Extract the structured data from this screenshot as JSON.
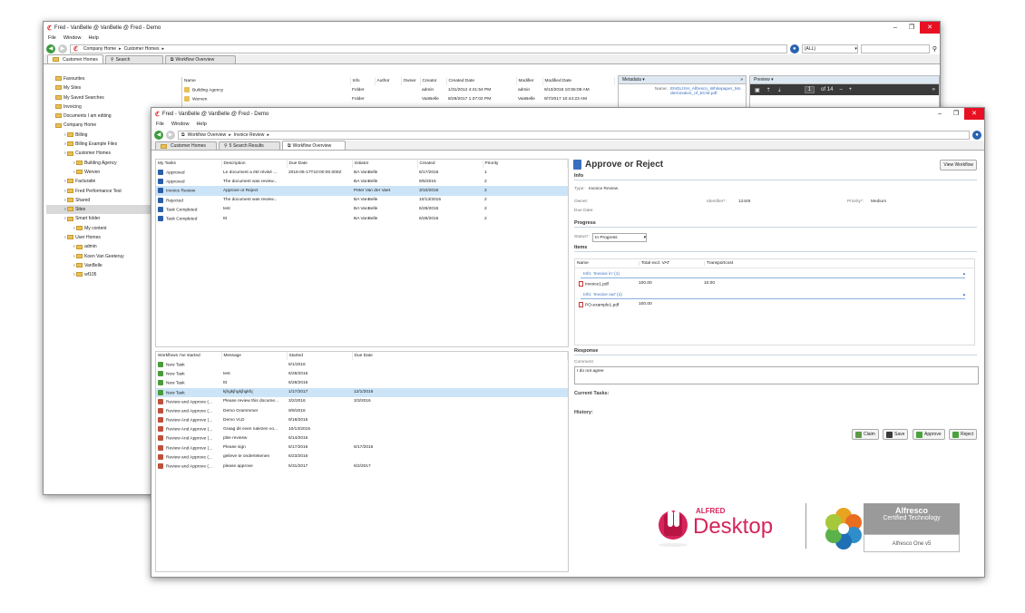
{
  "back_window": {
    "title": "Fred - VanBelle @ VanBelle @ Fred - Demo",
    "menu": [
      "File",
      "Window",
      "Help"
    ],
    "breadcrumb": [
      "Company Home",
      "Customer Homes"
    ],
    "scope_select": "(ALL)",
    "tabs": [
      "Customer Homes",
      "Search",
      "Workflow Overview"
    ],
    "tree": [
      {
        "label": "Favourites",
        "indent": 1
      },
      {
        "label": "My Sites",
        "indent": 1
      },
      {
        "label": "My Saved Searches",
        "indent": 1
      },
      {
        "label": "Invoicing",
        "indent": 1
      },
      {
        "label": "Documents I am editing",
        "indent": 1
      },
      {
        "label": "Company Home",
        "indent": 1
      },
      {
        "label": "Billing",
        "indent": 2
      },
      {
        "label": "Billing Example Files",
        "indent": 2
      },
      {
        "label": "Customer Homes",
        "indent": 2
      },
      {
        "label": "Building Agency",
        "indent": 3
      },
      {
        "label": "Werven",
        "indent": 3
      },
      {
        "label": "Facturatie",
        "indent": 2
      },
      {
        "label": "Fred Performance Test",
        "indent": 2
      },
      {
        "label": "Shared",
        "indent": 2
      },
      {
        "label": "Sites",
        "indent": 2,
        "selected": true
      },
      {
        "label": "Smart folder",
        "indent": 2
      },
      {
        "label": "My content",
        "indent": 3
      },
      {
        "label": "User Homes",
        "indent": 2
      },
      {
        "label": "admin",
        "indent": 3
      },
      {
        "label": "Koen Van Geeteruy",
        "indent": 3
      },
      {
        "label": "VanBelle",
        "indent": 3
      },
      {
        "label": "wf105",
        "indent": 3
      }
    ],
    "columns": [
      "Name",
      "Info",
      "Author",
      "Owner",
      "Creator",
      "Created Date",
      "Modifier",
      "Modified Date"
    ],
    "rows": [
      [
        "Building Agency",
        "Folder",
        "",
        "",
        "admin",
        "1/31/2012 4:41:54 PM",
        "admin",
        "9/13/2016 10:55:08 AM"
      ],
      [
        "Werven",
        "Folder",
        "",
        "",
        "VanBelle",
        "8/29/2017 1:37:02 PM",
        "VanBelle",
        "9/7/2017 10:44:23 AM"
      ]
    ],
    "metadata_header": "Metadata",
    "metadata_name_label": "Name:",
    "metadata_name_value": "ENGLISH_Alfresco_Whitepaper_Modernization_of_ECM.pdf",
    "preview_header": "Preview",
    "preview_page": "1",
    "preview_of": "of 14"
  },
  "front_window": {
    "title": "Fred - VanBelle @ VanBelle @ Fred - Demo",
    "menu": [
      "File",
      "Window",
      "Help"
    ],
    "breadcrumb": [
      "Workflow Overview",
      "Invoice Review"
    ],
    "tabs": [
      "Customer Homes",
      "5 Search Results",
      "Workflow Overview"
    ],
    "tasks_columns": [
      "My Tasks",
      "Description",
      "Due Date",
      "Initiator",
      "Created",
      "Priority"
    ],
    "tasks": [
      [
        "Approved",
        "Le document a été révisé ...",
        "2016-06-17T10:00:00.000Z",
        "BA VanBelle",
        "6/17/2016",
        "1"
      ],
      [
        "Approved",
        "The document was review...",
        "",
        "BA VanBelle",
        "9/5/2016",
        "2"
      ],
      [
        "Invoice Review",
        "Approve or Reject",
        "",
        "Peter Van der Vaet",
        "3/10/2015",
        "2"
      ],
      [
        "Rejected",
        "The document was review...",
        "",
        "BA VanBelle",
        "10/13/2015",
        "2"
      ],
      [
        "Task Completed",
        "test",
        "",
        "BA VanBelle",
        "6/28/2016",
        "2"
      ],
      [
        "Task Completed",
        "ttt",
        "",
        "BA VanBelle",
        "6/28/2016",
        "2"
      ]
    ],
    "wf_columns": [
      "Workflows I've started",
      "Message",
      "Started",
      "Due Date"
    ],
    "workflows": [
      [
        "New Task",
        "",
        "6/1/2016",
        ""
      ],
      [
        "New Task",
        "test",
        "6/28/2016",
        ""
      ],
      [
        "New Task",
        "ttt",
        "6/28/2016",
        ""
      ],
      [
        "New Task",
        "kjhgkjhgkjhgkhj",
        "1/17/2017",
        "12/1/2016"
      ],
      [
        "Review and Approve (...",
        "Please review this docume...",
        "3/2/2016",
        "3/3/2016"
      ],
      [
        "Review and Approve (...",
        "Demo Grammmer",
        "9/9/2016",
        ""
      ],
      [
        "Review And Approve (...",
        "Demo VLD",
        "9/18/2015",
        ""
      ],
      [
        "Review And Approve (...",
        "Graag dit even nalezen vo...",
        "10/13/2015",
        ""
      ],
      [
        "Review And Approve (...",
        "plse reviesw",
        "6/14/2016",
        ""
      ],
      [
        "Review And Approve (...",
        "Please sign",
        "6/17/2016",
        "6/17/2016"
      ],
      [
        "Review and Approve (...",
        "gelieve te ondertekenen",
        "6/23/2016",
        ""
      ],
      [
        "Review and Approve (...",
        "please approve",
        "5/31/2017",
        "6/2/2017"
      ]
    ],
    "detail": {
      "title": "Approve or Reject",
      "view_workflow": "View Workflow",
      "info_section": "Info",
      "type_label": "Type:",
      "type_value": "Invoice Review",
      "owner_label": "Owner:",
      "identifier_label": "Identifier*:",
      "identifier_value": "12449",
      "priority_label": "Priority*:",
      "priority_value": "Medium",
      "due_label": "Due Date:",
      "progress_section": "Progress",
      "status_label": "Status*:",
      "status_value": "In Progress",
      "items_section": "Items",
      "items_columns": [
        "Name",
        "Total excl. VAT",
        "Transportcost"
      ],
      "group1": "Info: 'Invoice in' (1)",
      "item1": [
        "Invoice1.pdf",
        "100.00",
        "10.00"
      ],
      "group2": "Info: 'Invoice out' (1)",
      "item2": [
        "PO-example1.pdf",
        "100.00",
        ""
      ],
      "response_section": "Response",
      "comment_label": "Comment",
      "comment_value": "I do not agree",
      "current_tasks": "Current Tasks:",
      "history": "History:",
      "buttons": [
        "Claim",
        "Save",
        "Approve",
        "Reject"
      ]
    },
    "logo": {
      "alfred_small": "ALFRED",
      "alfred_big": "Desktop",
      "alfresco_name": "Alfresco",
      "certified": "Certified Technology",
      "alfresco_one": "Alfresco One v5"
    }
  }
}
